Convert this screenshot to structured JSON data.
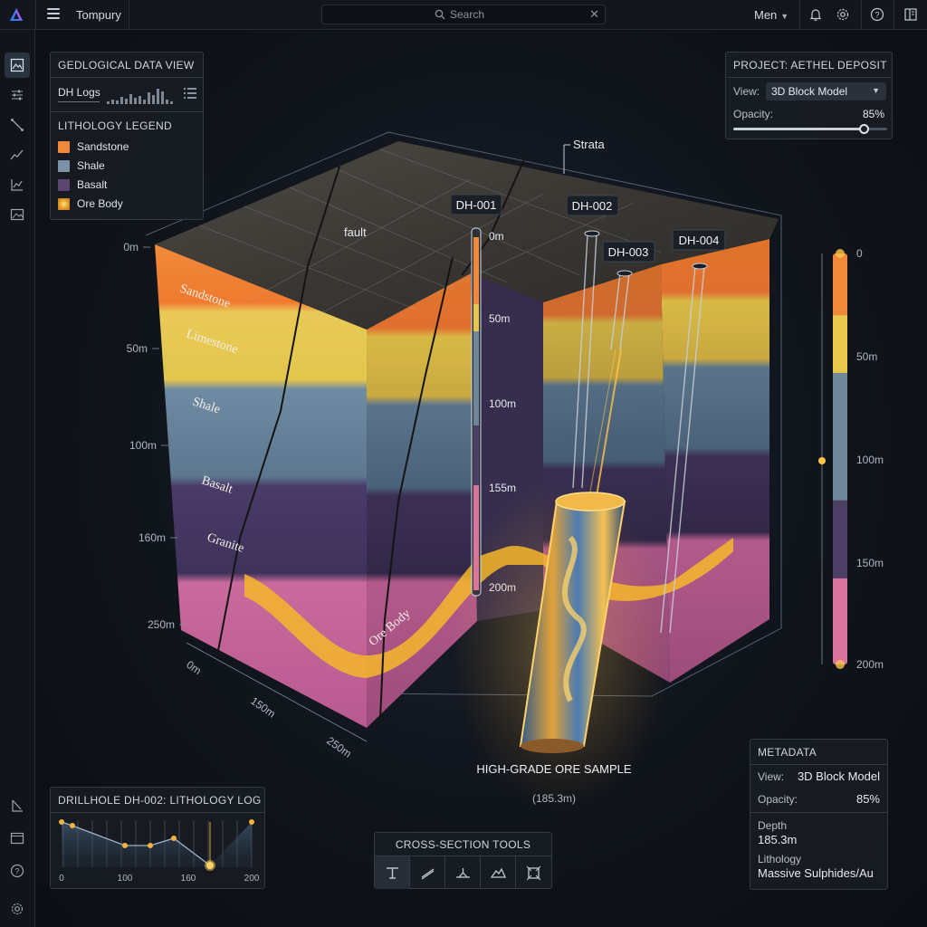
{
  "app": {
    "title": "Tompury",
    "search_placeholder": "Search",
    "user_menu": "Men"
  },
  "top_icons": [
    "bell-icon",
    "gear-icon",
    "help-icon",
    "panel-icon"
  ],
  "rail_icons": [
    "image-view-icon",
    "sliders-icon",
    "ruler-icon",
    "trend-icon",
    "chart-icon",
    "photo-icon",
    "measure-icon",
    "window-icon",
    "help-icon",
    "settings-icon"
  ],
  "geo_panel": {
    "title": "GEDLOGICAL DATA VIEW",
    "dh_logs": "DH Logs",
    "legend_title": "LITHOLOGY LEGEND",
    "legend": [
      {
        "label": "Sandstone",
        "color": "#f08a3a"
      },
      {
        "label": "Shale",
        "color": "#7b93a6"
      },
      {
        "label": "Basalt",
        "color": "#5b4672"
      },
      {
        "label": "Ore Body",
        "color": "#f5b72a"
      }
    ]
  },
  "project_panel": {
    "title": "PROJECT: AETHEL DEPOSIT",
    "view_label": "View:",
    "view_value": "3D Block Model",
    "opacity_label": "Opacity:",
    "opacity_value": "85%",
    "opacity_fraction": 0.85
  },
  "model": {
    "strata_label": "Strata",
    "fault_label": "fault",
    "layer_labels": [
      "Sandstone",
      "Limestone",
      "Shale",
      "Basalt",
      "Granite",
      "Ore Body"
    ],
    "depth_ticks": [
      "0m",
      "50m",
      "100m",
      "160m",
      "250m"
    ],
    "front_ticks": [
      "0m",
      "150m",
      "250m"
    ],
    "drillholes": [
      "DH-001",
      "DH-002",
      "DH-003",
      "DH-004"
    ],
    "dh001_ticks": [
      "0m",
      "50m",
      "100m",
      "155m",
      "200m"
    ],
    "sample_title": "HIGH-GRADE ORE SAMPLE",
    "sample_depth": "(185.3m)"
  },
  "depth_bar": {
    "ticks": [
      "0",
      "50m",
      "100m",
      "150m",
      "200m"
    ],
    "segments": [
      {
        "name": "sandstone",
        "color": "#f08a3a"
      },
      {
        "name": "limestone",
        "color": "#e6c84d"
      },
      {
        "name": "shale",
        "color": "#6f8799"
      },
      {
        "name": "basalt",
        "color": "#4d3e66"
      },
      {
        "name": "granite",
        "color": "#d9759c"
      }
    ]
  },
  "metadata": {
    "title": "METADATA",
    "view_label": "View:",
    "view_value": "3D Block Model",
    "opacity_label": "Opacity:",
    "opacity_value": "85%",
    "depth_label": "Depth",
    "depth_value": "185.3m",
    "lithology_label": "Lithology",
    "lithology_value": "Massive Sulphides/Au"
  },
  "drillhole_log": {
    "title": "DRILLHOLE DH-002: LITHOLOGY LOG",
    "x_ticks": [
      "0",
      "100",
      "160",
      "200"
    ]
  },
  "tools": {
    "title": "CROSS-SECTION TOOLS",
    "items": [
      "section-plane-icon",
      "slice-icon",
      "horizon-icon",
      "surface-icon",
      "extent-icon"
    ]
  }
}
